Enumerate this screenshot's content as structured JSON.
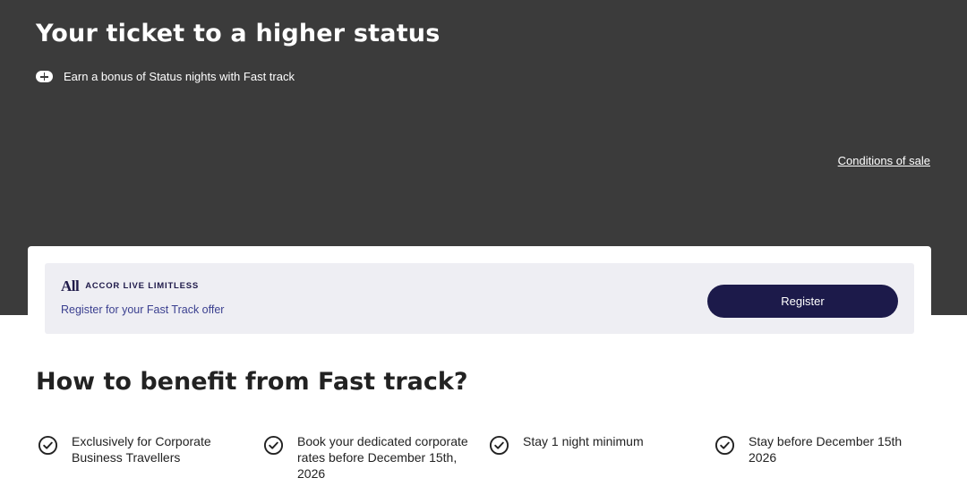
{
  "hero": {
    "title": "Your ticket to a higher status",
    "subtitle": "Earn a bonus of Status nights with Fast track",
    "subtitle_icon": "plus-icon",
    "conditions_link": "Conditions of sale"
  },
  "card": {
    "logo": "All",
    "brand": "ACCOR LIVE LIMITLESS",
    "description": "Register for your Fast Track offer",
    "register_label": "Register"
  },
  "how": {
    "title": "How to benefit from Fast track?",
    "benefits": [
      {
        "icon": "check-circle-icon",
        "text": "Exclusively for Corporate Business Travellers"
      },
      {
        "icon": "check-circle-icon",
        "text": "Book your dedicated corporate rates before December 15th, 2026"
      },
      {
        "icon": "check-circle-icon",
        "text": "Stay 1 night minimum"
      },
      {
        "icon": "check-circle-icon",
        "text": "Stay before December 15th 2026"
      }
    ]
  },
  "colors": {
    "hero_bg": "#3b3b3b",
    "button_bg": "#1c1a4a",
    "card_bg": "#eeeef3",
    "link_text": "#3a3f8f"
  }
}
